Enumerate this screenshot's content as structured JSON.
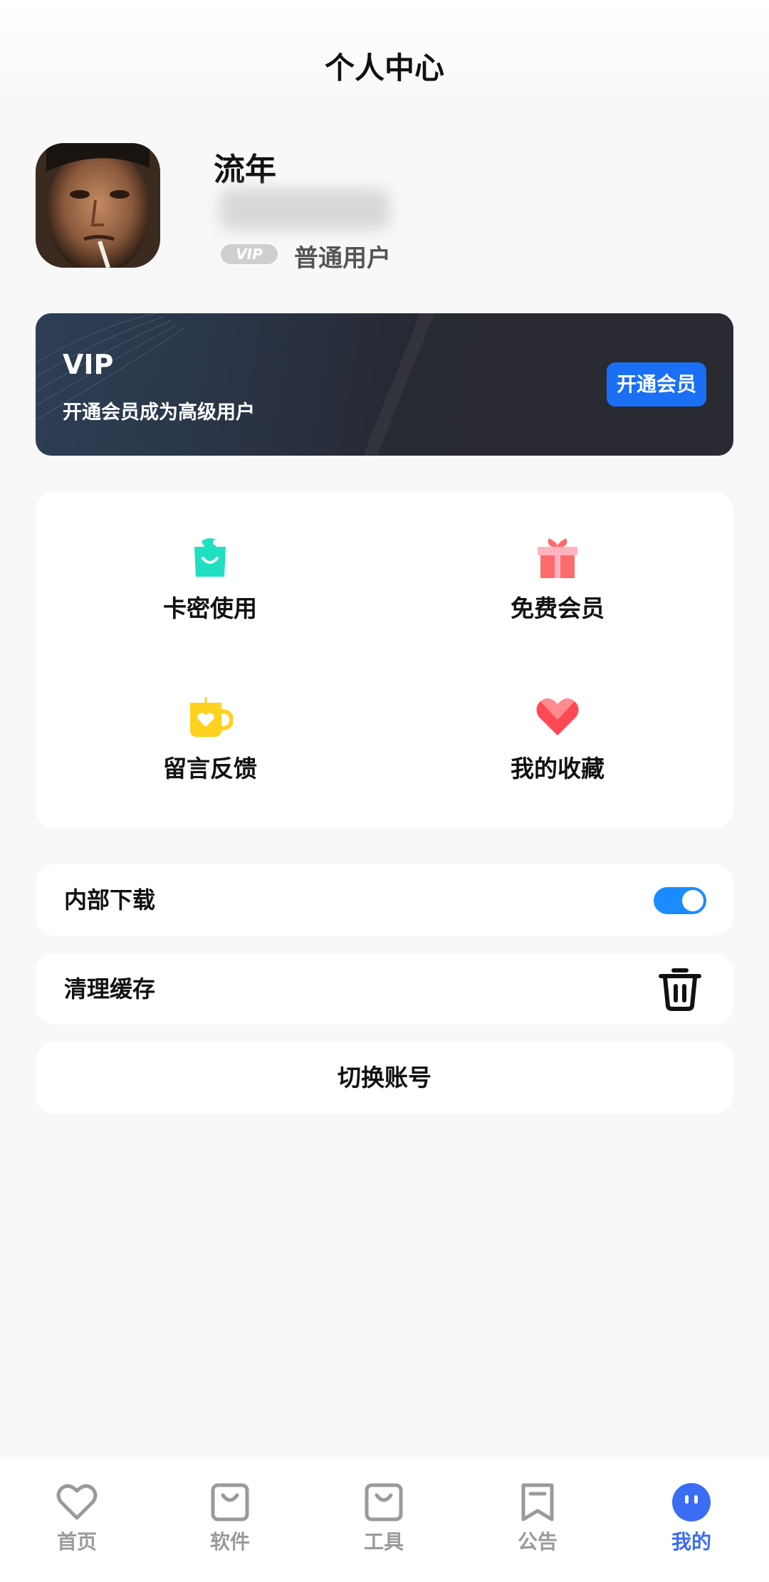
{
  "header": {
    "title": "个人中心"
  },
  "profile": {
    "username": "流年",
    "user_id": "*** ****",
    "badge": "VIP",
    "level": "普通用户"
  },
  "vip_banner": {
    "title": "VIP",
    "subtitle": "开通会员成为高级用户",
    "button": "开通会员"
  },
  "grid": {
    "items": [
      {
        "label": "卡密使用",
        "icon": "shopping-bag-icon",
        "color": "#1fe0c0"
      },
      {
        "label": "免费会员",
        "icon": "gift-icon",
        "color": "#ff6a6a"
      },
      {
        "label": "留言反馈",
        "icon": "cup-heart-icon",
        "color": "#ffd21f"
      },
      {
        "label": "我的收藏",
        "icon": "heart-icon",
        "color": "#ff4a55"
      }
    ]
  },
  "settings": {
    "internal_download": {
      "label": "内部下载",
      "enabled": true
    },
    "clear_cache": {
      "label": "清理缓存",
      "icon": "trash-icon"
    },
    "switch_account": {
      "label": "切换账号"
    }
  },
  "bottom_nav": {
    "items": [
      {
        "label": "首页",
        "icon": "heart-outline-icon",
        "active": false
      },
      {
        "label": "软件",
        "icon": "bag-outline-icon",
        "active": false
      },
      {
        "label": "工具",
        "icon": "bag-outline-icon",
        "active": false
      },
      {
        "label": "公告",
        "icon": "bookmark-outline-icon",
        "active": false
      },
      {
        "label": "我的",
        "icon": "face-icon",
        "active": true
      }
    ]
  },
  "colors": {
    "accent": "#1a6ff5",
    "toggle_on": "#1a8cff",
    "nav_active": "#3a6cf4",
    "nav_inactive": "#9a9a9a"
  }
}
